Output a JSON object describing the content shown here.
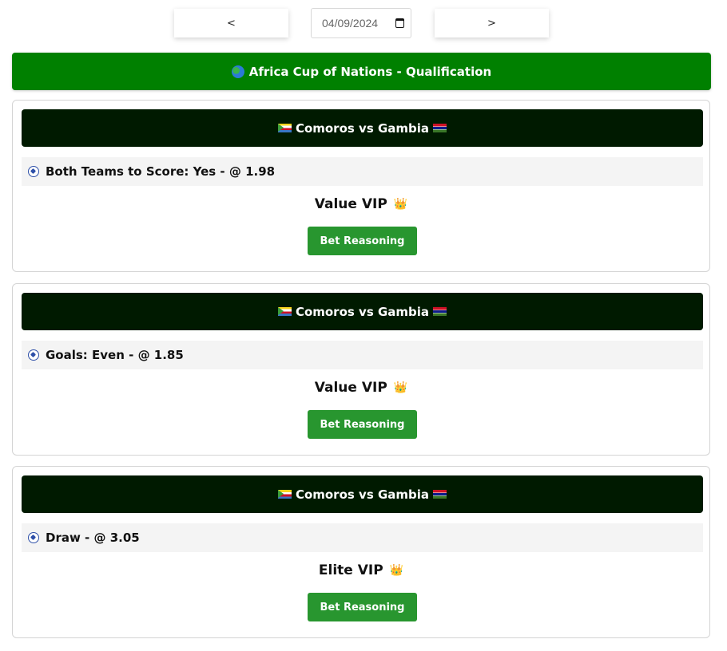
{
  "date_nav": {
    "prev_label": "<",
    "next_label": ">",
    "date_value": "04/09/2024"
  },
  "league": {
    "title": "Africa Cup of Nations - Qualification",
    "icon": "globe-icon"
  },
  "cards": [
    {
      "match": "Comoros vs Gambia",
      "tip": "Both Teams to Score: Yes - @ 1.98",
      "tier": "Value VIP",
      "button": "Bet Reasoning"
    },
    {
      "match": "Comoros vs Gambia",
      "tip": "Goals: Even - @ 1.85",
      "tier": "Value VIP",
      "button": "Bet Reasoning"
    },
    {
      "match": "Comoros vs Gambia",
      "tip": "Draw - @ 3.05",
      "tier": "Elite VIP",
      "button": "Bet Reasoning"
    }
  ],
  "icons": {
    "crown": "👑"
  },
  "colors": {
    "league_bg": "#008000",
    "match_bg": "#001a00",
    "button_bg": "#28962f"
  }
}
